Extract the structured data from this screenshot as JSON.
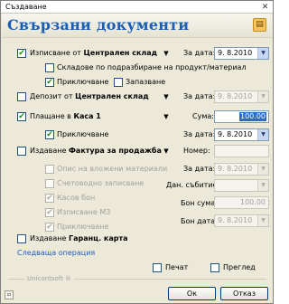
{
  "window": {
    "title": "Създаване",
    "close_glyph": "✕"
  },
  "header": {
    "title": "Свързани документи",
    "icon": "note-icon"
  },
  "date_label": "За дата:",
  "issue": {
    "label_prefix": "Изписване от",
    "warehouse": "Централен склад",
    "date": "9. 8.2010",
    "sub": {
      "storage_label": "Складове по подразбиране на продукт/материал",
      "post_label": "Приключване",
      "reserve_label": "Запазване"
    }
  },
  "deposit": {
    "label_prefix": "Депозит от",
    "warehouse": "Централен склад",
    "date": "9. 8.2010"
  },
  "payment": {
    "label_prefix": "Плащане в",
    "cashbox": "Каса 1",
    "sum_label": "Сума:",
    "sum_value": "100.00",
    "post_label": "Приключване",
    "date": "9. 8.2010"
  },
  "invoice": {
    "label_prefix": "Издаване",
    "doc_type": "Фактура за продажба",
    "number_label": "Номер:",
    "number_value": "",
    "sub_items": [
      {
        "label": "Опис на вложени материали",
        "checked": false
      },
      {
        "label": "Счетоводно записване",
        "checked": false
      },
      {
        "label": "Касов бон",
        "checked": true
      },
      {
        "label": "Изписване МЗ",
        "checked": true
      },
      {
        "label": "Приключване",
        "checked": true
      }
    ],
    "date": "9. 8.2010",
    "tax_event_label": "Дан. събитие:",
    "tax_event_value": "",
    "receipt_sum_label": "Бон сума:",
    "receipt_sum_value": "100.00",
    "receipt_date_label": "Бон дата:",
    "receipt_date": "9. 8.2010"
  },
  "warranty": {
    "label_prefix": "Издаване",
    "doc_type": "Гаранц. карта"
  },
  "next_operation_link": "Следваща операция",
  "print_label": "Печат",
  "preview_label": "Преглед",
  "brand": "Unicontsoft ®",
  "ok_label": "Ок",
  "cancel_label": "Отказ",
  "check_glyph": "✔"
}
